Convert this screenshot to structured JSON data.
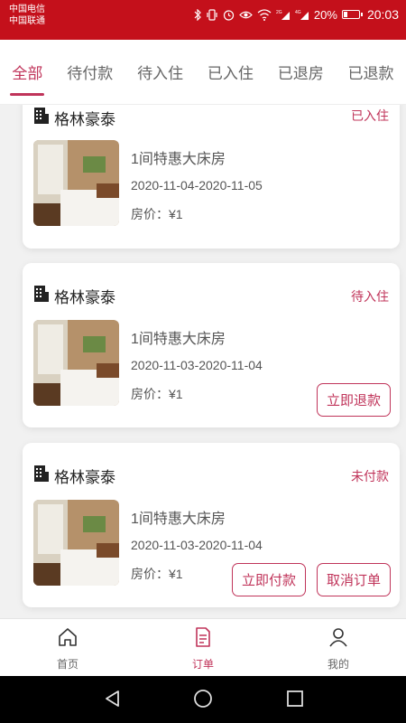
{
  "statusbar": {
    "carrier1": "中国电信",
    "carrier2": "中国联通",
    "battery": "20%",
    "time": "20:03",
    "net1": "2G",
    "net2": "4G"
  },
  "tabs": [
    {
      "label": "全部",
      "active": true
    },
    {
      "label": "待付款",
      "active": false
    },
    {
      "label": "待入住",
      "active": false
    },
    {
      "label": "已入住",
      "active": false
    },
    {
      "label": "已退房",
      "active": false
    },
    {
      "label": "已退款",
      "active": false
    }
  ],
  "orders": [
    {
      "hotel": "格林豪泰",
      "status": "已入住",
      "room": "1间特惠大床房",
      "dates": "2020-11-04-2020-11-05",
      "price": "房价：¥1",
      "buttons": []
    },
    {
      "hotel": "格林豪泰",
      "status": "待入住",
      "room": "1间特惠大床房",
      "dates": "2020-11-03-2020-11-04",
      "price": "房价：¥1",
      "buttons": [
        "立即退款"
      ]
    },
    {
      "hotel": "格林豪泰",
      "status": "未付款",
      "room": "1间特惠大床房",
      "dates": "2020-11-03-2020-11-04",
      "price": "房价：¥1",
      "buttons": [
        "立即付款",
        "取消订单"
      ]
    }
  ],
  "bottom_nav": [
    {
      "label": "首页",
      "icon": "home-icon",
      "active": false
    },
    {
      "label": "订单",
      "icon": "order-icon",
      "active": true
    },
    {
      "label": "我的",
      "icon": "user-icon",
      "active": false
    }
  ],
  "colors": {
    "statusbar": "#c4101b",
    "accent": "#c0345a"
  }
}
